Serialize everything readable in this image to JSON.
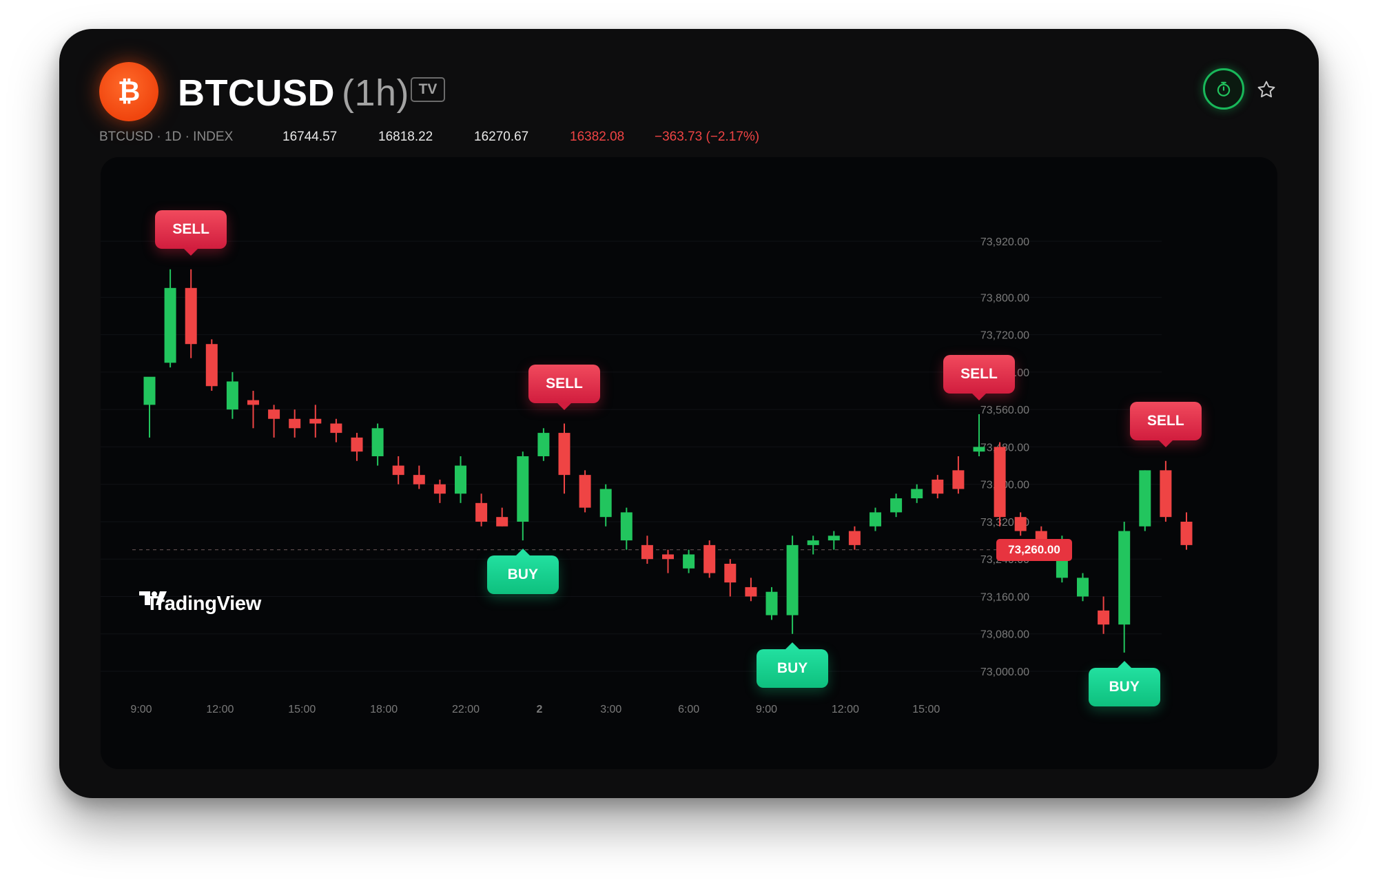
{
  "header": {
    "symbol": "BTCUSD",
    "interval": "(1h)",
    "badge": "TV",
    "coin_glyph": "₿",
    "coin_icon": "bitcoin-icon",
    "timer_icon": "stopwatch-icon",
    "favorite_icon": "star-icon"
  },
  "info": {
    "source": "BTCUSD · 1D · INDEX",
    "open": "16744.57",
    "high": "16818.22",
    "low": "16270.67",
    "close": "16382.08",
    "change": "−363.73 (−2.17%)"
  },
  "colors": {
    "up": "#22c55e",
    "down": "#ef4444",
    "accent_orange": "#f0450e",
    "buy_badge": "#10d090",
    "sell_badge": "#e0294a",
    "price_line": "#e7343f"
  },
  "branding": {
    "logo_text": "TradingView"
  },
  "chart_data": {
    "type": "candlestick",
    "y_ticks": [
      "73,920.00",
      "73,800.00",
      "73,720.00",
      "73,640.00",
      "73,560.00",
      "73,480.00",
      "73,400.00",
      "73,320.00",
      "73,240.00",
      "73,160.00",
      "73,080.00",
      "73,000.00"
    ],
    "y_tick_values": [
      73920,
      73800,
      73720,
      73640,
      73560,
      73480,
      73400,
      73320,
      73240,
      73160,
      73080,
      73000
    ],
    "x_ticks": [
      "9:00",
      "12:00",
      "15:00",
      "18:00",
      "22:00",
      "2",
      "3:00",
      "6:00",
      "9:00",
      "12:00",
      "15:00"
    ],
    "ylim": [
      73000,
      73920
    ],
    "current_price": 73260,
    "current_price_label": "73,260.00",
    "candles": [
      {
        "o": 73570,
        "h": 73600,
        "l": 73500,
        "c": 73630
      },
      {
        "o": 73660,
        "h": 73860,
        "l": 73650,
        "c": 73820
      },
      {
        "o": 73820,
        "h": 73860,
        "l": 73670,
        "c": 73700
      },
      {
        "o": 73700,
        "h": 73710,
        "l": 73600,
        "c": 73610
      },
      {
        "o": 73560,
        "h": 73640,
        "l": 73540,
        "c": 73620
      },
      {
        "o": 73580,
        "h": 73600,
        "l": 73520,
        "c": 73570
      },
      {
        "o": 73560,
        "h": 73570,
        "l": 73500,
        "c": 73540
      },
      {
        "o": 73540,
        "h": 73560,
        "l": 73500,
        "c": 73520
      },
      {
        "o": 73540,
        "h": 73570,
        "l": 73500,
        "c": 73530
      },
      {
        "o": 73530,
        "h": 73540,
        "l": 73490,
        "c": 73510
      },
      {
        "o": 73500,
        "h": 73510,
        "l": 73450,
        "c": 73470
      },
      {
        "o": 73460,
        "h": 73530,
        "l": 73440,
        "c": 73520
      },
      {
        "o": 73440,
        "h": 73460,
        "l": 73400,
        "c": 73420
      },
      {
        "o": 73420,
        "h": 73440,
        "l": 73390,
        "c": 73400
      },
      {
        "o": 73400,
        "h": 73410,
        "l": 73360,
        "c": 73380
      },
      {
        "o": 73380,
        "h": 73460,
        "l": 73360,
        "c": 73440
      },
      {
        "o": 73360,
        "h": 73380,
        "l": 73310,
        "c": 73320
      },
      {
        "o": 73330,
        "h": 73350,
        "l": 73310,
        "c": 73310
      },
      {
        "o": 73320,
        "h": 73470,
        "l": 73280,
        "c": 73460
      },
      {
        "o": 73460,
        "h": 73520,
        "l": 73450,
        "c": 73510
      },
      {
        "o": 73510,
        "h": 73530,
        "l": 73380,
        "c": 73420
      },
      {
        "o": 73420,
        "h": 73430,
        "l": 73340,
        "c": 73350
      },
      {
        "o": 73330,
        "h": 73400,
        "l": 73310,
        "c": 73390
      },
      {
        "o": 73280,
        "h": 73350,
        "l": 73260,
        "c": 73340
      },
      {
        "o": 73270,
        "h": 73290,
        "l": 73230,
        "c": 73240
      },
      {
        "o": 73250,
        "h": 73260,
        "l": 73210,
        "c": 73240
      },
      {
        "o": 73220,
        "h": 73260,
        "l": 73210,
        "c": 73250
      },
      {
        "o": 73270,
        "h": 73280,
        "l": 73200,
        "c": 73210
      },
      {
        "o": 73230,
        "h": 73240,
        "l": 73160,
        "c": 73190
      },
      {
        "o": 73180,
        "h": 73200,
        "l": 73150,
        "c": 73160
      },
      {
        "o": 73120,
        "h": 73180,
        "l": 73110,
        "c": 73170
      },
      {
        "o": 73120,
        "h": 73290,
        "l": 73080,
        "c": 73270
      },
      {
        "o": 73270,
        "h": 73290,
        "l": 73250,
        "c": 73280
      },
      {
        "o": 73280,
        "h": 73300,
        "l": 73260,
        "c": 73290
      },
      {
        "o": 73300,
        "h": 73310,
        "l": 73260,
        "c": 73270
      },
      {
        "o": 73310,
        "h": 73350,
        "l": 73300,
        "c": 73340
      },
      {
        "o": 73340,
        "h": 73380,
        "l": 73330,
        "c": 73370
      },
      {
        "o": 73370,
        "h": 73400,
        "l": 73360,
        "c": 73390
      },
      {
        "o": 73410,
        "h": 73420,
        "l": 73370,
        "c": 73380
      },
      {
        "o": 73430,
        "h": 73460,
        "l": 73380,
        "c": 73390
      },
      {
        "o": 73470,
        "h": 73550,
        "l": 73460,
        "c": 73480
      },
      {
        "o": 73480,
        "h": 73490,
        "l": 73310,
        "c": 73330
      },
      {
        "o": 73330,
        "h": 73340,
        "l": 73290,
        "c": 73300
      },
      {
        "o": 73300,
        "h": 73310,
        "l": 73260,
        "c": 73280
      },
      {
        "o": 73200,
        "h": 73290,
        "l": 73190,
        "c": 73260
      },
      {
        "o": 73160,
        "h": 73210,
        "l": 73150,
        "c": 73200
      },
      {
        "o": 73130,
        "h": 73160,
        "l": 73080,
        "c": 73100
      },
      {
        "o": 73100,
        "h": 73320,
        "l": 73040,
        "c": 73300
      },
      {
        "o": 73310,
        "h": 73430,
        "l": 73300,
        "c": 73430
      },
      {
        "o": 73430,
        "h": 73450,
        "l": 73320,
        "c": 73330
      },
      {
        "o": 73320,
        "h": 73340,
        "l": 73260,
        "c": 73270
      }
    ],
    "signals": [
      {
        "type": "sell",
        "label": "SELL",
        "candle": 2
      },
      {
        "type": "sell",
        "label": "SELL",
        "candle": 20
      },
      {
        "type": "buy",
        "label": "BUY",
        "candle": 18
      },
      {
        "type": "buy",
        "label": "BUY",
        "candle": 31
      },
      {
        "type": "sell",
        "label": "SELL",
        "candle": 40
      },
      {
        "type": "sell",
        "label": "SELL",
        "candle": 49
      },
      {
        "type": "buy",
        "label": "BUY",
        "candle": 47
      }
    ]
  }
}
